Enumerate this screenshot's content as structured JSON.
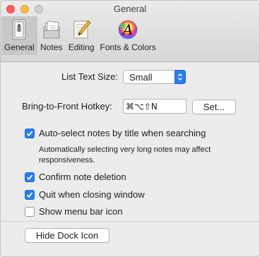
{
  "window": {
    "title": "General"
  },
  "toolbar": {
    "tabs": [
      {
        "label": "General",
        "icon": "general-switch-icon",
        "selected": true
      },
      {
        "label": "Notes",
        "icon": "notes-icon",
        "selected": false
      },
      {
        "label": "Editing",
        "icon": "editing-icon",
        "selected": false
      },
      {
        "label": "Fonts & Colors",
        "icon": "fonts-colors-icon",
        "selected": false
      }
    ]
  },
  "settings": {
    "list_text_size": {
      "label": "List Text Size:",
      "value": "Small"
    },
    "hotkey": {
      "label": "Bring-to-Front Hotkey:",
      "value": "⌘⌥⇧N",
      "set_button": "Set..."
    },
    "auto_select": {
      "label": "Auto-select notes by title when searching",
      "checked": true,
      "note": "Automatically selecting very long notes may affect responsiveness."
    },
    "confirm_delete": {
      "label": "Confirm note deletion",
      "checked": true
    },
    "quit_on_close": {
      "label": "Quit when closing window",
      "checked": true
    },
    "menu_bar_icon": {
      "label": "Show menu bar icon",
      "checked": false
    },
    "dock_button": "Hide Dock Icon"
  },
  "colors": {
    "accent": "#2b7de9",
    "close": "#fc605c",
    "minimize": "#fdbc40"
  }
}
